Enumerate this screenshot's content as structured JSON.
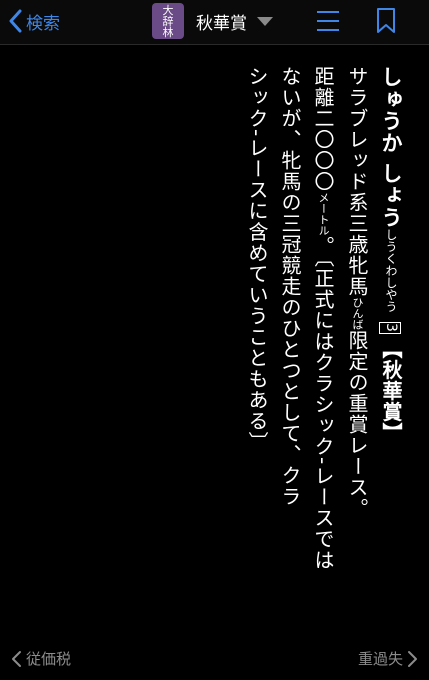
{
  "topbar": {
    "back_label": "検索",
    "dict_logo": [
      "大",
      "辞",
      "林"
    ],
    "title": "秋華賞"
  },
  "entry": {
    "headword": "しゅうか しょう",
    "reading": "しうくわしやう",
    "sense_number": "3",
    "kanji": "【秋華賞】",
    "line1_a": "サラブレッド系三歳牝馬",
    "line1_ruby": "ひんば",
    "line1_b": "限定の重賞レース。",
    "line2_a": "距離二〇〇〇",
    "line2_unit": "メートル",
    "line2_b": "。〔正式にはクラシック-レースでは",
    "line3": "ないが、牝馬の三冠競走のひとつとして、クラ",
    "line4": "シック-レースに含めていうこともある〕"
  },
  "footer": {
    "prev_label": "従価税",
    "next_label": "重過失"
  },
  "colors": {
    "accent": "#3f86e6",
    "background": "#000000",
    "muted": "#8c8c8c",
    "logo": "#6b4b87"
  }
}
